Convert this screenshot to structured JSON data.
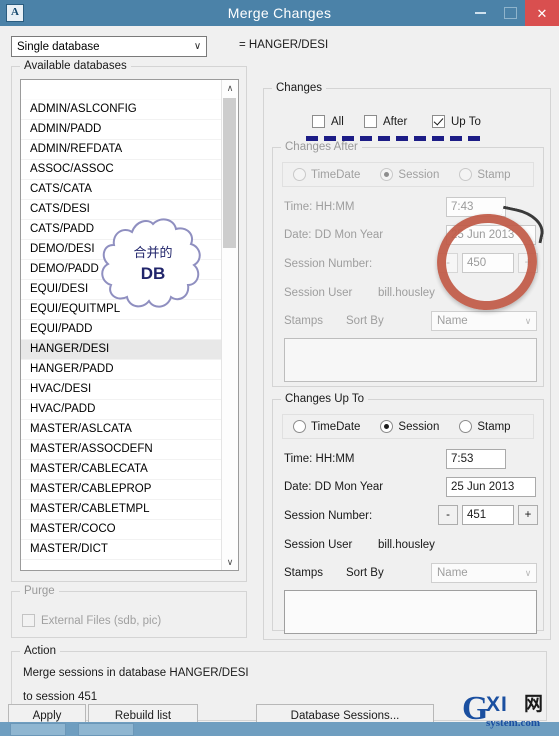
{
  "window": {
    "title": "Merge Changes",
    "app_icon": "A",
    "minimize_label": "Minimize",
    "maximize_label": "Maximize",
    "close_label": "Close"
  },
  "top": {
    "mode_combo_value": "Single database",
    "mode_combo_arrow": "∨",
    "equals_text": "= HANGER/DESI"
  },
  "available": {
    "group_title": "Available databases",
    "items": [
      "",
      "ADMIN/ASLCONFIG",
      "ADMIN/PADD",
      "ADMIN/REFDATA",
      "ASSOC/ASSOC",
      "CATS/CATA",
      "CATS/DESI",
      "CATS/PADD",
      "DEMO/DESI",
      "DEMO/PADD",
      "EQUI/DESI",
      "EQUI/EQUITMPL",
      "EQUI/PADD",
      "HANGER/DESI",
      "HANGER/PADD",
      "HVAC/DESI",
      "HVAC/PADD",
      "MASTER/ASLCATA",
      "MASTER/ASSOCDEFN",
      "MASTER/CABLECATA",
      "MASTER/CABLEPROP",
      "MASTER/CABLETMPL",
      "MASTER/COCO",
      "MASTER/DICT"
    ],
    "selected": "HANGER/DESI",
    "scroll_up_arrow": "∧",
    "scroll_down_arrow": "∨"
  },
  "annotation_cloud": {
    "line1": "合并的",
    "line2": "DB"
  },
  "purge": {
    "group_title": "Purge",
    "checkbox_label": "External Files (sdb, pic)",
    "checked": false,
    "enabled": false
  },
  "action": {
    "group_title": "Action",
    "line1": "Merge sessions in database HANGER/DESI",
    "line2": "to session 451"
  },
  "changes": {
    "group_title": "Changes",
    "checkboxes": [
      {
        "label": "All",
        "checked": false
      },
      {
        "label": "After",
        "checked": false
      },
      {
        "label": "Up To",
        "checked": true
      }
    ],
    "after": {
      "group_title": "Changes After",
      "enabled": false,
      "radios": [
        {
          "label": "TimeDate",
          "selected": false
        },
        {
          "label": "Session",
          "selected": true
        },
        {
          "label": "Stamp",
          "selected": false
        }
      ],
      "time_label": "Time: HH:MM",
      "time_value": "7:43",
      "date_label": "Date: DD Mon Year",
      "date_value": "25 Jun 2013",
      "session_label": "Session Number:",
      "session_value": "450",
      "spin_minus": "-",
      "spin_plus": "+",
      "user_label": "Session User",
      "user_value": "bill.housley",
      "stamps_label": "Stamps",
      "sortby_label": "Sort By",
      "sortby_value": "Name",
      "sortby_arrow": "∨"
    },
    "upto": {
      "group_title": "Changes Up To",
      "enabled": true,
      "radios": [
        {
          "label": "TimeDate",
          "selected": false
        },
        {
          "label": "Session",
          "selected": true
        },
        {
          "label": "Stamp",
          "selected": false
        }
      ],
      "time_label": "Time: HH:MM",
      "time_value": "7:53",
      "date_label": "Date: DD Mon Year",
      "date_value": "25 Jun 2013",
      "session_label": "Session Number:",
      "session_value": "451",
      "spin_minus": "-",
      "spin_plus": "+",
      "user_label": "Session User",
      "user_value": "bill.housley",
      "stamps_label": "Stamps",
      "sortby_label": "Sort By",
      "sortby_value": "Name",
      "sortby_arrow": "∨"
    }
  },
  "buttons": {
    "apply": "Apply",
    "rebuild": "Rebuild list",
    "db_sessions": "Database Sessions..."
  },
  "watermark": {
    "g": "G",
    "xi": "XI",
    "net": "网",
    "sub": "system.com"
  },
  "colors": {
    "titlebar": "#4b82a8",
    "close": "#d94f4f",
    "annotation_blue": "#1c1c86",
    "annotation_red": "#c15a46",
    "taskbar": "#6f9ec0"
  }
}
